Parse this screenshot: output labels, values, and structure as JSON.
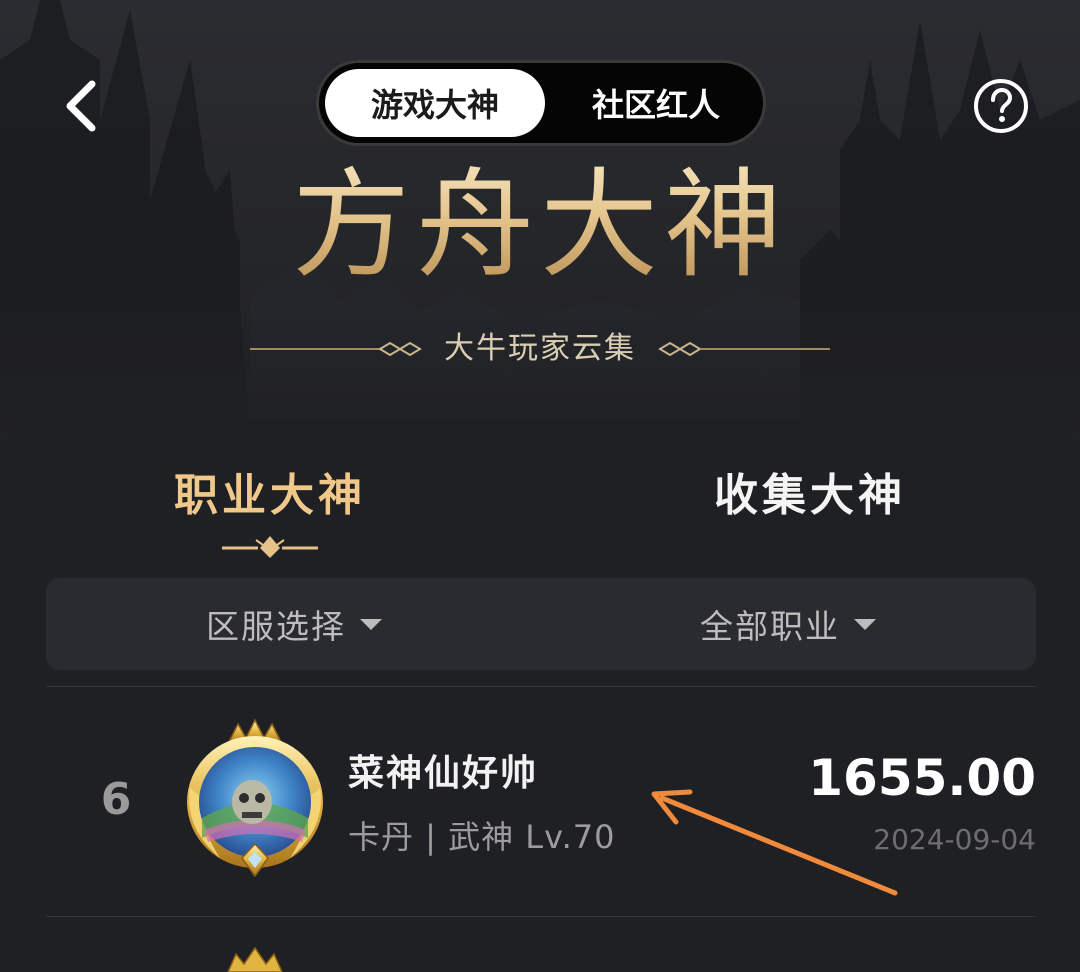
{
  "header": {
    "back_icon": "chevron-left-icon",
    "help_icon": "question-circle-icon",
    "toggle": {
      "active_label": "游戏大神",
      "inactive_label": "社区红人"
    },
    "title": "方舟大神",
    "subtitle": "大牛玩家云集"
  },
  "tabs": {
    "active_label": "职业大神",
    "inactive_label": "收集大神"
  },
  "filters": {
    "server_label": "区服选择",
    "class_label": "全部职业"
  },
  "leaderboard": {
    "rows": [
      {
        "rank": "6",
        "name": "菜神仙好帅",
        "meta": "卡丹 | 武神 Lv.70",
        "score": "1655.00",
        "date": "2024-09-04"
      }
    ]
  },
  "colors": {
    "gold_accent": "#f0c88a",
    "background": "#1f2024",
    "annotation_arrow": "#f28a3c"
  }
}
